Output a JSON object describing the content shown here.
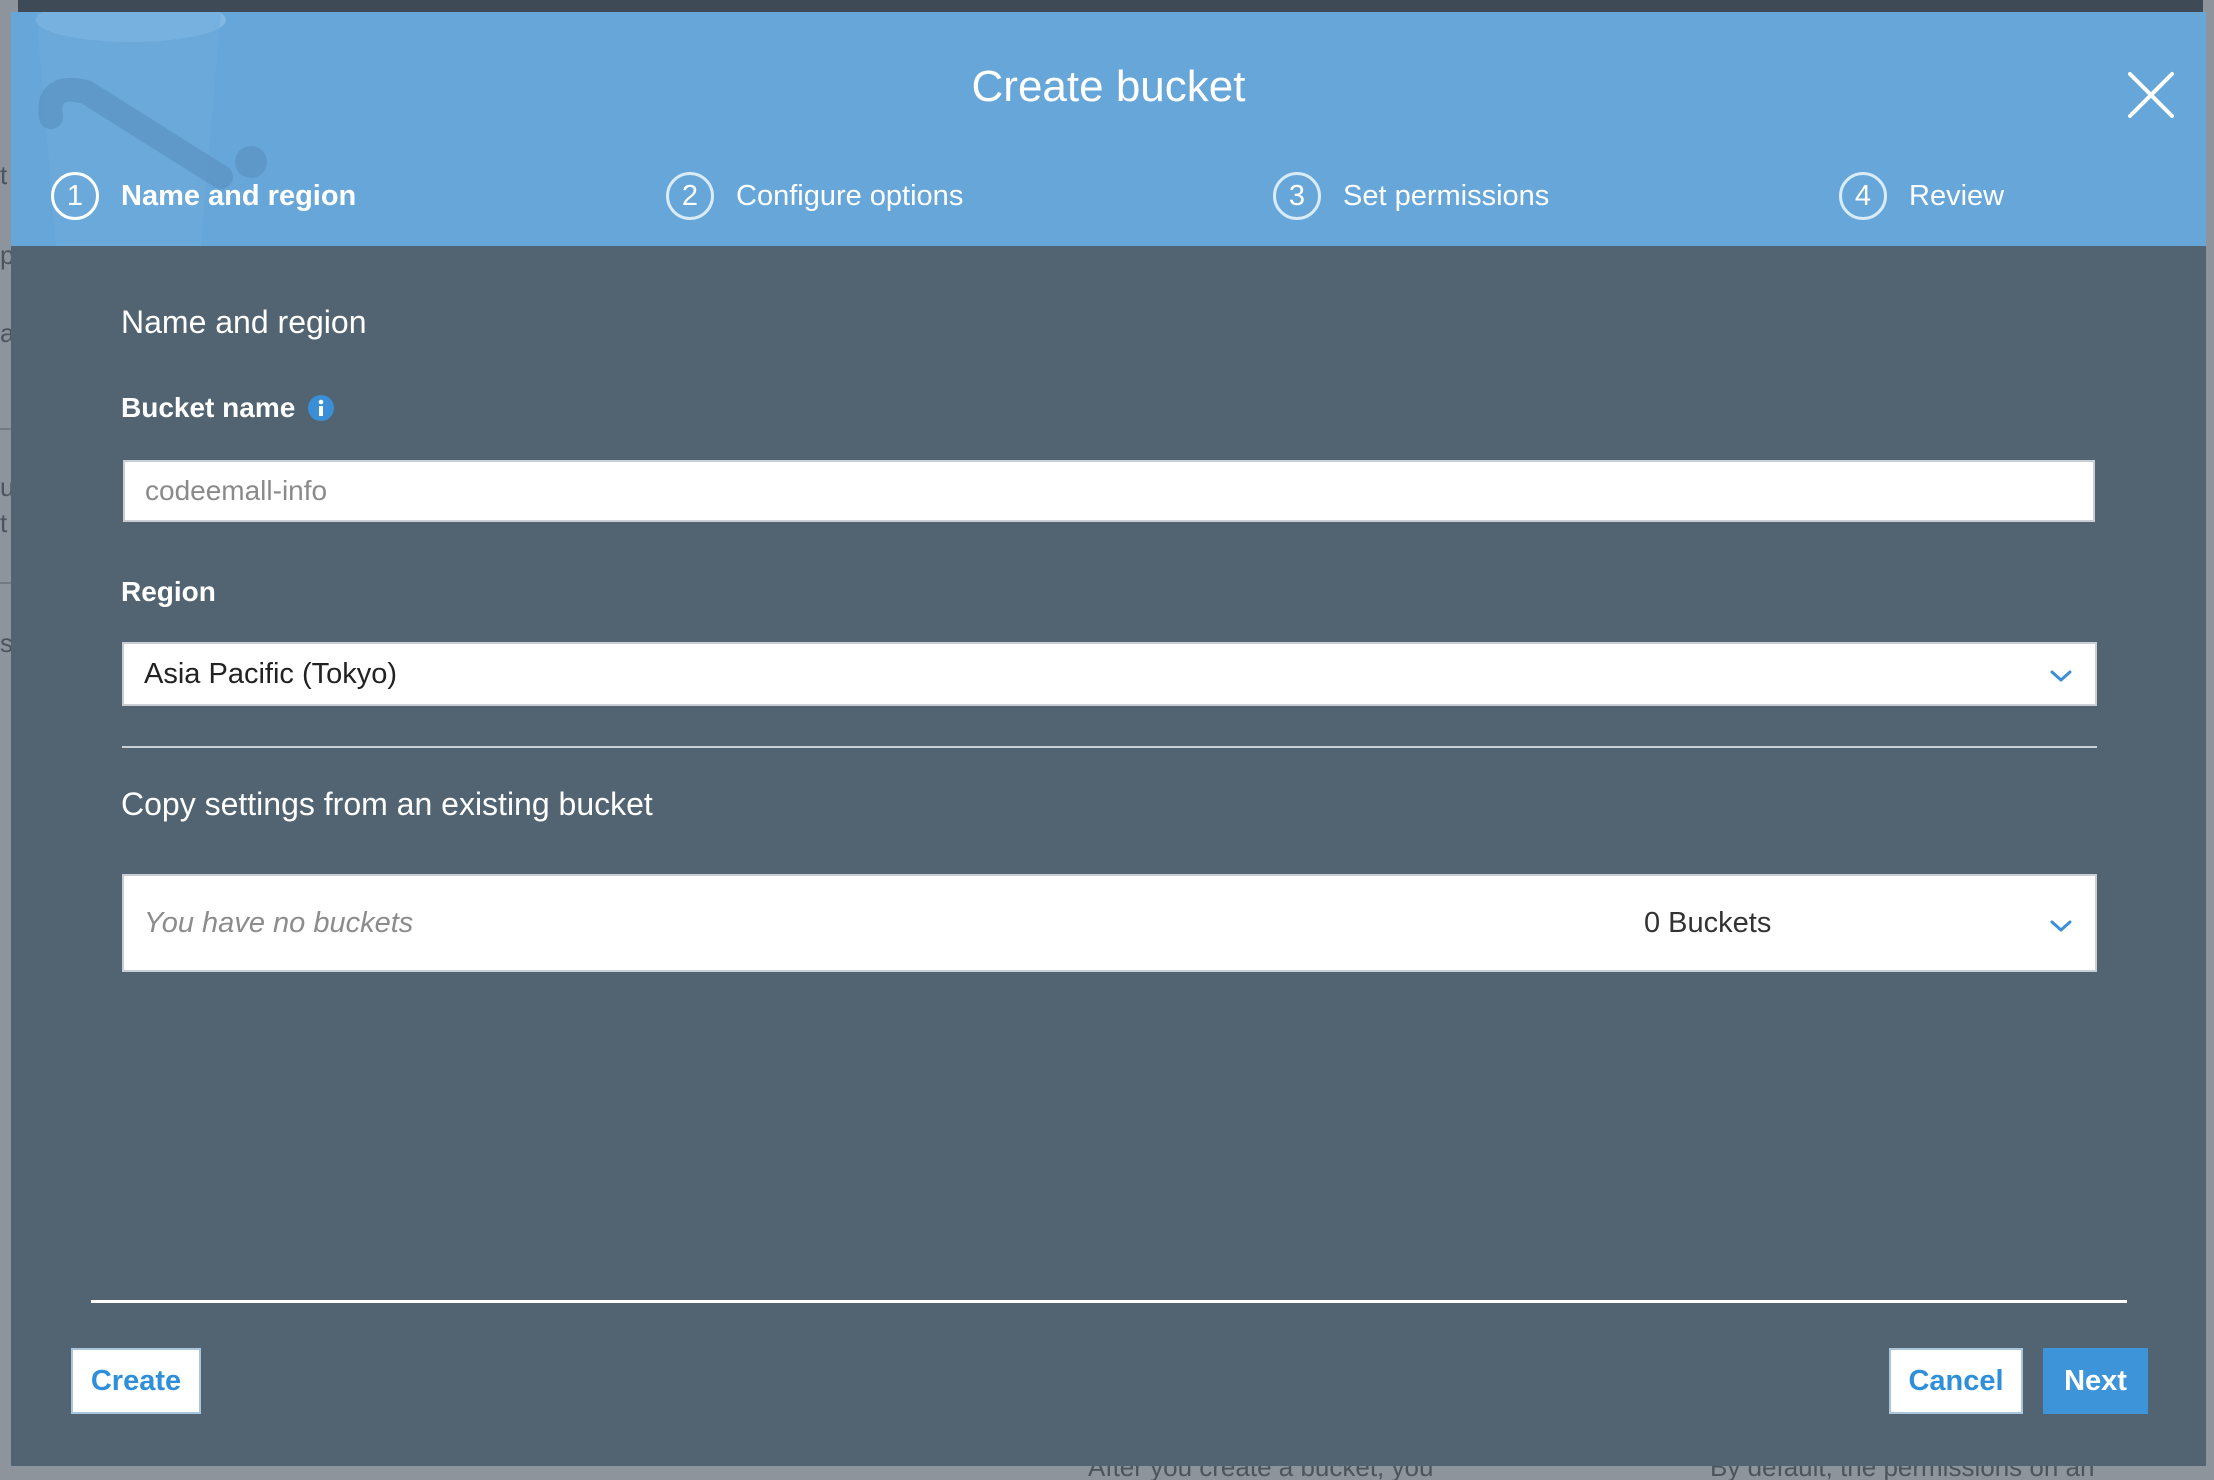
{
  "background": {
    "fragments": [
      "t",
      "p",
      "a",
      "u",
      "t",
      "s"
    ],
    "bottom_left_text": "After you create a bucket, you",
    "bottom_right_text": "By default, the permissions on an"
  },
  "modal": {
    "title": "Create bucket",
    "close_icon": "close-icon",
    "steps": [
      {
        "number": "1",
        "label": "Name and region",
        "active": true
      },
      {
        "number": "2",
        "label": "Configure options",
        "active": false
      },
      {
        "number": "3",
        "label": "Set permissions",
        "active": false
      },
      {
        "number": "4",
        "label": "Review",
        "active": false
      }
    ],
    "section_title": "Name and region",
    "bucket_name": {
      "label": "Bucket name",
      "info_icon": "info-icon",
      "placeholder": "codeemall-info",
      "value": ""
    },
    "region": {
      "label": "Region",
      "selected": "Asia Pacific (Tokyo)"
    },
    "copy_settings": {
      "title": "Copy settings from an existing bucket",
      "placeholder": "You have no buckets",
      "count": "0 Buckets"
    },
    "footer": {
      "create_label": "Create",
      "cancel_label": "Cancel",
      "next_label": "Next"
    }
  },
  "colors": {
    "header": "#67a6d8",
    "body": "#526472",
    "accent": "#3e94d9"
  }
}
